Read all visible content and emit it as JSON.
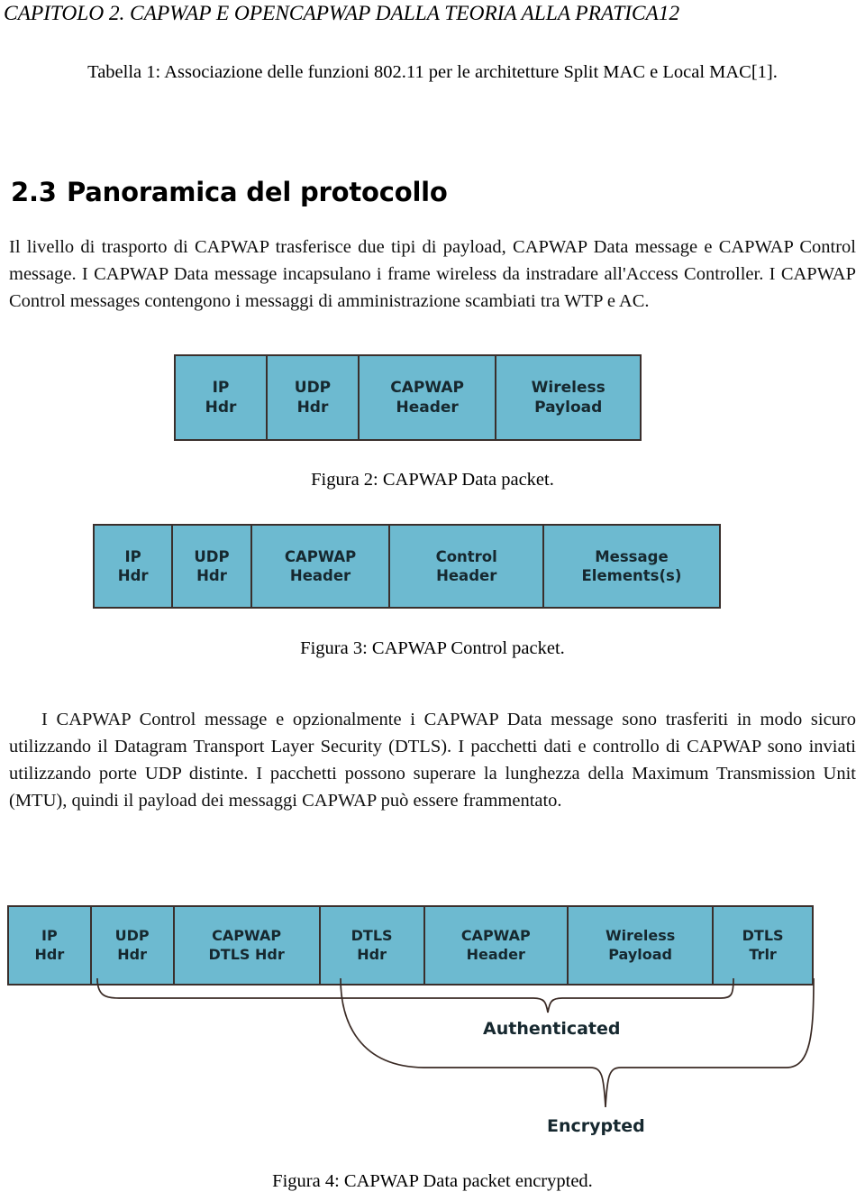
{
  "page": {
    "running_header": "CAPITOLO 2.  CAPWAP E OPENCAPWAP DALLA TEORIA ALLA PRATICA12",
    "table_caption": "Tabella 1: Associazione delle funzioni 802.11 per le architetture Split MAC e Local MAC[1].",
    "section": {
      "number": "2.3",
      "title": "Panoramica del protocollo"
    },
    "paragraphs": [
      "Il livello di trasporto di CAPWAP trasferisce due tipi di payload, CAPWAP Data message e CAPWAP Control message. I CAPWAP Data message incapsulano i frame wireless da instradare all'Access Controller. I CAPWAP Control messages contengono i messaggi di amministrazione scambiati tra WTP e AC.",
      "I CAPWAP Control message e opzionalmente i CAPWAP Data message sono trasferiti in modo sicuro utilizzando il Datagram Transport Layer Security (DTLS). I pacchetti dati e controllo di CAPWAP sono inviati utilizzando porte UDP distinte. I pacchetti possono superare la lunghezza della Maximum Transmission Unit (MTU), quindi il payload dei messaggi CAPWAP può essere frammentato."
    ]
  },
  "colors": {
    "packet_fill": "#6dbad0",
    "packet_border": "#3a2f2c",
    "packet_text": "#16282f",
    "brace_stroke": "#3a2a24"
  },
  "figures": [
    {
      "id": "fig2",
      "caption": "Figura 2: CAPWAP Data packet.",
      "cells": [
        {
          "line1": "IP",
          "line2": "Hdr",
          "width_pct": 19.8
        },
        {
          "line1": "UDP",
          "line2": "Hdr",
          "width_pct": 19.8
        },
        {
          "line1": "CAPWAP",
          "line2": "Header",
          "width_pct": 29.6
        },
        {
          "line1": "Wireless",
          "line2": "Payload",
          "width_pct": 30.8
        }
      ]
    },
    {
      "id": "fig3",
      "caption": "Figura 3: CAPWAP Control packet.",
      "cells": [
        {
          "line1": "IP",
          "line2": "Hdr",
          "width_pct": 12.6
        },
        {
          "line1": "UDP",
          "line2": "Hdr",
          "width_pct": 12.6
        },
        {
          "line1": "CAPWAP",
          "line2": "Header",
          "width_pct": 22.2
        },
        {
          "line1": "Control",
          "line2": "Header",
          "width_pct": 24.6
        },
        {
          "line1": "Message",
          "line2": "Elements(s)",
          "width_pct": 28.0
        }
      ]
    },
    {
      "id": "fig4",
      "caption": "Figura 4: CAPWAP Data packet encrypted.",
      "cells": [
        {
          "line1": "IP",
          "line2": "Hdr",
          "width_pct": 10.3
        },
        {
          "line1": "UDP",
          "line2": "Hdr",
          "width_pct": 10.3
        },
        {
          "line1": "CAPWAP",
          "line2": "DTLS Hdr",
          "width_pct": 18.2
        },
        {
          "line1": "DTLS",
          "line2": "Hdr",
          "width_pct": 13.0
        },
        {
          "line1": "CAPWAP",
          "line2": "Header",
          "width_pct": 17.9
        },
        {
          "line1": "Wireless",
          "line2": "Payload",
          "width_pct": 18.1
        },
        {
          "line1": "DTLS",
          "line2": "Trlr",
          "width_pct": 12.2
        }
      ],
      "annotations": [
        {
          "name": "authenticated",
          "label": "Authenticated"
        },
        {
          "name": "encrypted",
          "label": "Encrypted"
        }
      ]
    }
  ]
}
